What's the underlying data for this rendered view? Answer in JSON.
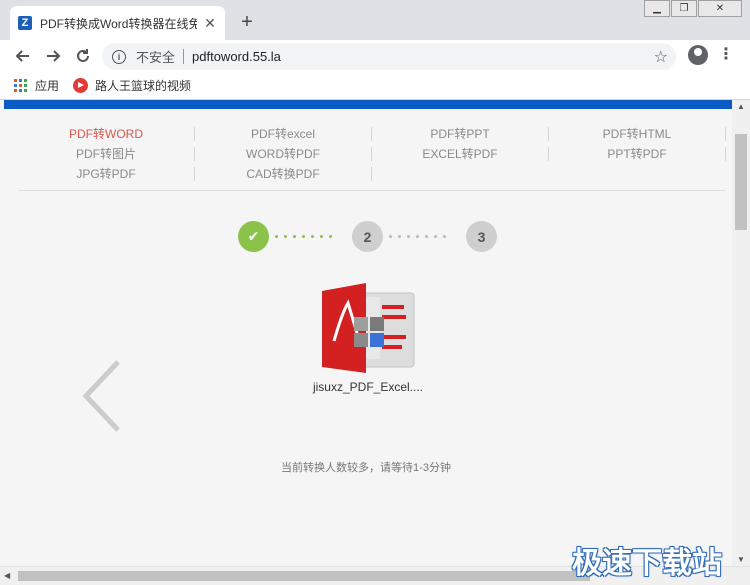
{
  "browser": {
    "tab_title": "PDF转换成Word转换器在线免费",
    "favicon_letter": "Z",
    "close_symbol": "✕",
    "newtab_symbol": "+",
    "window_buttons": [
      "▁",
      "❐",
      "✕"
    ],
    "insecure_label": "不安全",
    "url": "pdftoword.55.la",
    "star_symbol": "☆",
    "menu_symbol": "⋮"
  },
  "bookmarks": [
    {
      "label": "应用",
      "icon": "apps-grid-icon"
    },
    {
      "label": "路人王篮球的视频",
      "icon": "video-icon"
    }
  ],
  "nav": {
    "rows": [
      [
        "PDF转WORD",
        "PDF转excel",
        "PDF转PPT",
        "PDF转HTML"
      ],
      [
        "PDF转图片",
        "WORD转PDF",
        "EXCEL转PDF",
        "PPT转PDF"
      ],
      [
        "JPG转PDF",
        "CAD转换PDF"
      ]
    ],
    "active": "PDF转WORD"
  },
  "steps": {
    "step1_symbol": "✔",
    "step2": "2",
    "step3": "3",
    "completed": 1
  },
  "file": {
    "name": "jisuxz_PDF_Excel...."
  },
  "status_message": "当前转换人数较多，请等待1-3分钟",
  "watermark": "极速下载站",
  "colors": {
    "accent_blue": "#0a5cc4",
    "active_nav": "#d6584e",
    "step_done": "#8bc34a",
    "pdf_red": "#d32020"
  }
}
